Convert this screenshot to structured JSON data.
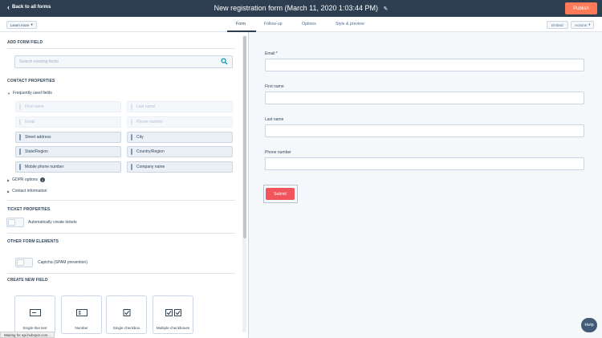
{
  "header": {
    "back_label": "Back to all forms",
    "form_title": "New registration form (March 11, 2020 1:03:44 PM)",
    "publish_label": "Publish"
  },
  "subbar": {
    "learn_more_label": "Learn more",
    "tabs": [
      {
        "label": "Form",
        "active": true
      },
      {
        "label": "Follow-up",
        "active": false
      },
      {
        "label": "Options",
        "active": false
      },
      {
        "label": "Style & preview",
        "active": false
      }
    ],
    "embed_label": "Embed",
    "actions_label": "Actions"
  },
  "sidebar": {
    "add_form_field_heading": "ADD FORM FIELD",
    "search_placeholder": "Search existing fields",
    "contact_properties_heading": "CONTACT PROPERTIES",
    "frequently_used_label": "Frequently used fields",
    "fields": [
      {
        "label": "First name",
        "disabled": true
      },
      {
        "label": "Last name",
        "disabled": true
      },
      {
        "label": "Email",
        "disabled": true
      },
      {
        "label": "Phone number",
        "disabled": true
      },
      {
        "label": "Street address",
        "disabled": false
      },
      {
        "label": "City",
        "disabled": false
      },
      {
        "label": "State/Region",
        "disabled": false
      },
      {
        "label": "Country/Region",
        "disabled": false
      },
      {
        "label": "Mobile phone number",
        "disabled": false
      },
      {
        "label": "Company name",
        "disabled": false
      }
    ],
    "gdpr_label": "GDPR options",
    "contact_info_label": "Contact information",
    "ticket_properties_heading": "TICKET PROPERTIES",
    "auto_tickets_label": "Automatically create tickets",
    "other_elements_heading": "OTHER FORM ELEMENTS",
    "captcha_label": "Captcha (SPAM prevention)",
    "create_new_field_heading": "CREATE NEW FIELD",
    "new_field_types": [
      {
        "label": "Single-line text",
        "icon": "single-line-text-icon"
      },
      {
        "label": "Number",
        "icon": "number-icon"
      },
      {
        "label": "Single checkbox",
        "icon": "single-checkbox-icon"
      },
      {
        "label": "Multiple checkboxes",
        "icon": "multiple-checkboxes-icon"
      }
    ]
  },
  "status_bar": {
    "text": "Waiting for api.hubspot.com..."
  },
  "preview": {
    "fields": [
      {
        "label": "Email *"
      },
      {
        "label": "First name"
      },
      {
        "label": "Last name"
      },
      {
        "label": "Phone number"
      }
    ],
    "submit_label": "Submit"
  },
  "help_label": "Help",
  "colors": {
    "topbar": "#2d3e50",
    "publish": "#ff7a59",
    "submit": "#f2545b",
    "help": "#425b76"
  }
}
